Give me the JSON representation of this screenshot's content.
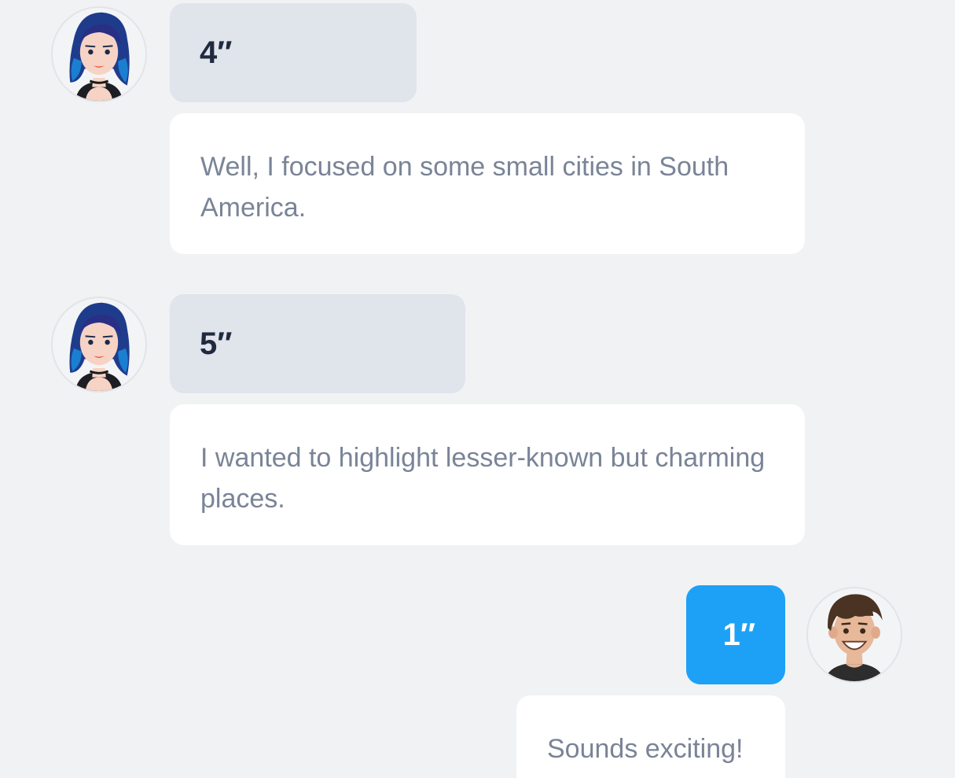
{
  "chat": {
    "messages": [
      {
        "sender": "contact",
        "duration": "4″",
        "text": "Well, I focused on some small cities in South America."
      },
      {
        "sender": "contact",
        "duration": "5″",
        "text": "I wanted to highlight lesser-known but charming places."
      },
      {
        "sender": "self",
        "duration": "1″",
        "text": "Sounds exciting!"
      }
    ]
  },
  "colors": {
    "background": "#f1f2f4",
    "incoming_duration_bg": "#e0e4eb",
    "outgoing_duration_bg": "#1da1f6",
    "bubble_bg": "#ffffff",
    "bubble_text": "#7a8497",
    "duration_text": "#1f2a3f"
  },
  "icons": {
    "contact_avatar": "woman-avatar-icon",
    "self_avatar": "man-avatar-icon"
  }
}
